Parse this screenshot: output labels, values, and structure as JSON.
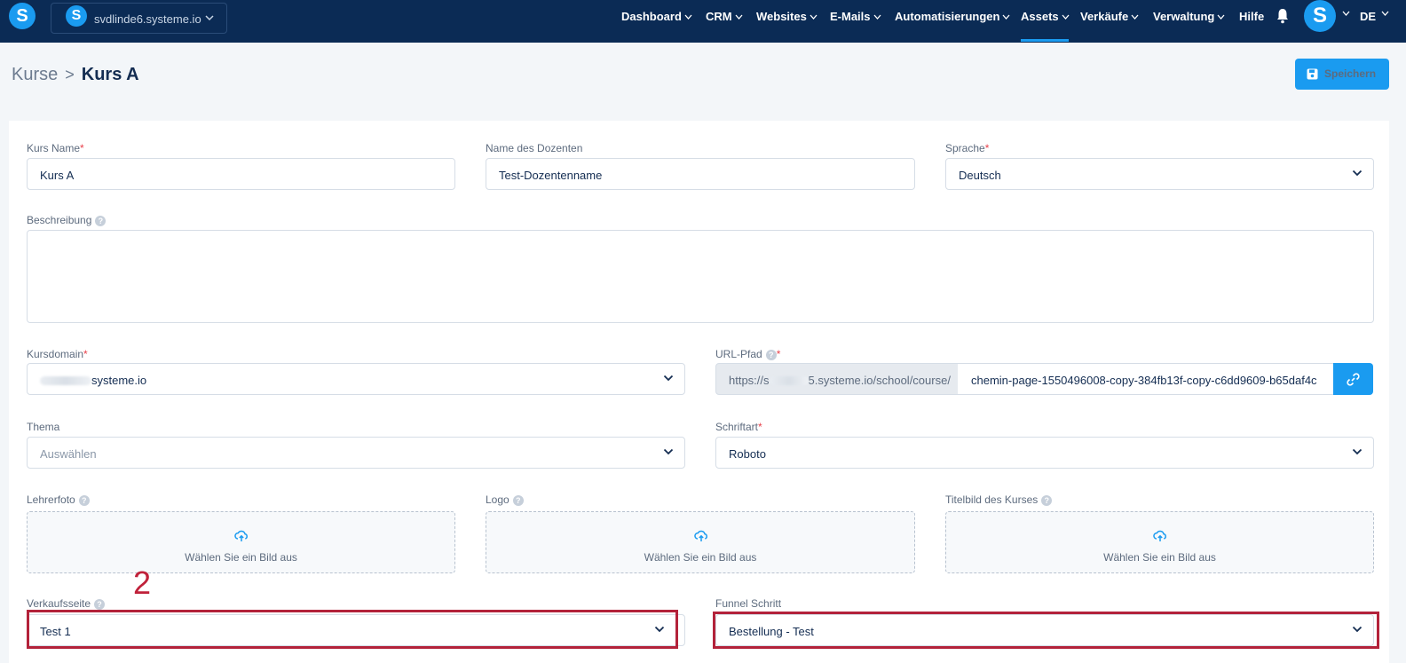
{
  "nav": {
    "workspace": "svdlinde6.systeme.io",
    "menu": [
      "Dashboard",
      "CRM",
      "Websites",
      "E-Mails",
      "Automatisierungen",
      "Assets",
      "Verkäufe",
      "Verwaltung"
    ],
    "help": "Hilfe",
    "language": "DE",
    "logo_letter": "S",
    "active": "Assets"
  },
  "breadcrumb": {
    "root": "Kurse",
    "separator": ">",
    "current": "Kurs A"
  },
  "save_button": "Speichern",
  "form": {
    "course_name": {
      "label": "Kurs Name",
      "required": "*",
      "value": "Kurs A"
    },
    "instructor": {
      "label": "Name des Dozenten",
      "value": "Test-Dozentenname"
    },
    "language": {
      "label": "Sprache",
      "required": "*",
      "value": "Deutsch"
    },
    "description": {
      "label": "Beschreibung",
      "value": ""
    },
    "domain": {
      "label": "Kursdomain",
      "required": "*",
      "value": "systeme.io"
    },
    "url_path": {
      "label": "URL-Pfad",
      "required": "*",
      "prefix_start": "https://s",
      "prefix_end": "5.systeme.io/school/course/",
      "value": "chemin-page-1550496008-copy-384fb13f-copy-c6dd9609-b65daf4c"
    },
    "theme": {
      "label": "Thema",
      "placeholder": "Auswählen"
    },
    "font": {
      "label": "Schriftart",
      "required": "*",
      "value": "Roboto"
    },
    "teacher_photo": {
      "label": "Lehrerfoto",
      "upload_text": "Wählen Sie ein Bild aus"
    },
    "logo": {
      "label": "Logo",
      "upload_text": "Wählen Sie ein Bild aus"
    },
    "cover": {
      "label": "Titelbild des Kurses",
      "upload_text": "Wählen Sie ein Bild aus"
    },
    "sales_page": {
      "label": "Verkaufsseite",
      "value": "Test 1"
    },
    "funnel_step": {
      "label": "Funnel Schritt",
      "value": "Bestellung - Test"
    }
  },
  "annotation": {
    "number": "2"
  },
  "colors": {
    "nav_bg": "#0b2b55",
    "accent": "#1a9bf0",
    "annotation": "#b3223a",
    "required": "#e8414b"
  }
}
